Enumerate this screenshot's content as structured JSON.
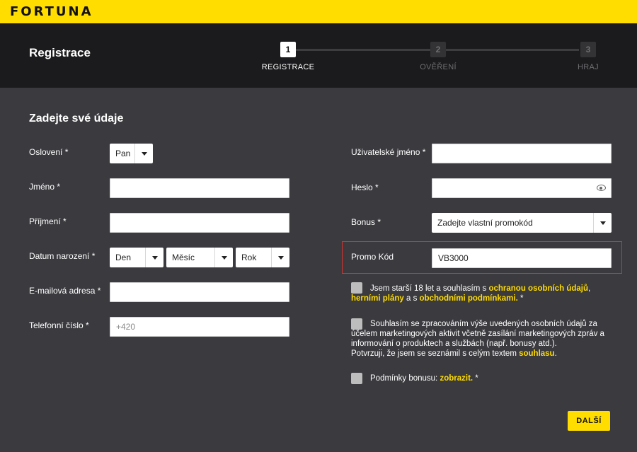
{
  "brand": {
    "logo": "FORTUNA",
    "accent": "#ffdd00"
  },
  "header": {
    "title": "Registrace"
  },
  "steps": [
    {
      "num": "1",
      "label": "REGISTRACE",
      "active": true
    },
    {
      "num": "2",
      "label": "OVĚŘENÍ",
      "active": false
    },
    {
      "num": "3",
      "label": "HRAJ",
      "active": false
    }
  ],
  "form": {
    "title": "Zadejte své údaje",
    "salutation": {
      "label": "Oslovení *",
      "value": "Pan"
    },
    "first_name": {
      "label": "Jméno *",
      "value": ""
    },
    "last_name": {
      "label": "Příjmení *",
      "value": ""
    },
    "birthdate": {
      "label": "Datum narození *",
      "day": "Den",
      "month": "Měsíc",
      "year": "Rok"
    },
    "email": {
      "label": "E-mailová adresa *",
      "value": ""
    },
    "phone": {
      "label": "Telefonní číslo *",
      "placeholder": "+420"
    },
    "username": {
      "label": "Uživatelské jméno *",
      "value": ""
    },
    "password": {
      "label": "Heslo *",
      "value": ""
    },
    "bonus": {
      "label": "Bonus *",
      "value": "Zadejte vlastní promokód"
    },
    "promo": {
      "label": "Promo Kód",
      "value": "VB3000"
    }
  },
  "consents": {
    "age": {
      "t1": "Jsem starší 18 let a souhlasím s ",
      "l1": "ochranou osobních údajů",
      "t2": ", ",
      "l2": "herními plány",
      "t3": " a s ",
      "l3": "obchodními podmínkami.",
      "t4": " *"
    },
    "marketing": {
      "line1": "Souhlasím se zpracováním výše uvedených osobních údajů za",
      "line2": "účelem marketingových aktivit včetně zasílání marketingových zpráv a",
      "line3": "informování o produktech a službách (např. bonusy atd.).",
      "line4": "Potvrzuji, že jsem se seznámil s celým textem ",
      "link": "souhlasu",
      "end": "."
    },
    "bonus_terms": {
      "t1": "Podmínky bonusu: ",
      "link": "zobrazit.",
      "t2": " *"
    }
  },
  "buttons": {
    "next": "DALŠÍ"
  }
}
